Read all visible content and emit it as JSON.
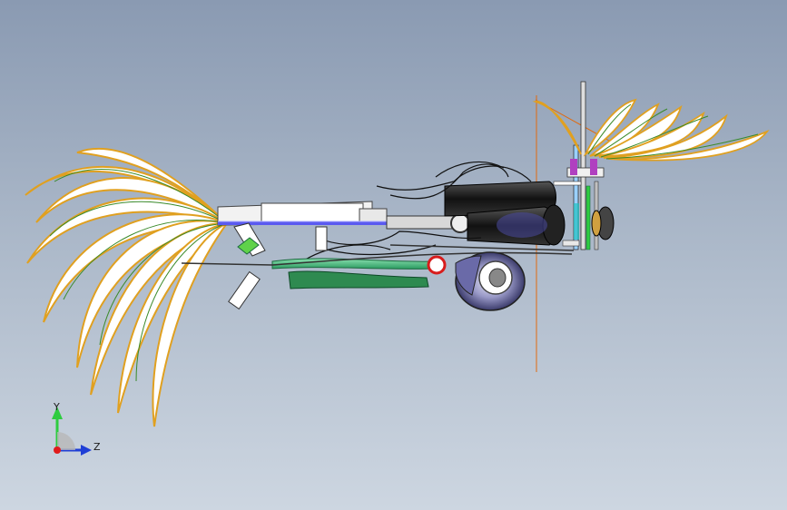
{
  "viewport": {
    "background_top": "#8a9ab2",
    "background_bottom": "#cdd6e1"
  },
  "triad": {
    "y_label": "Y",
    "z_label": "Z",
    "y_color": "#2ecc40",
    "z_color": "#1f3fd6",
    "origin_color": "#e01b1b"
  },
  "model": {
    "feather_stroke": "#e0a020",
    "feather_fill": "#ffffff",
    "accent_green": "#3cb371",
    "accent_blue": "#5a5af0",
    "accent_red": "#d81c1c",
    "centerline_color": "#e06a10"
  }
}
